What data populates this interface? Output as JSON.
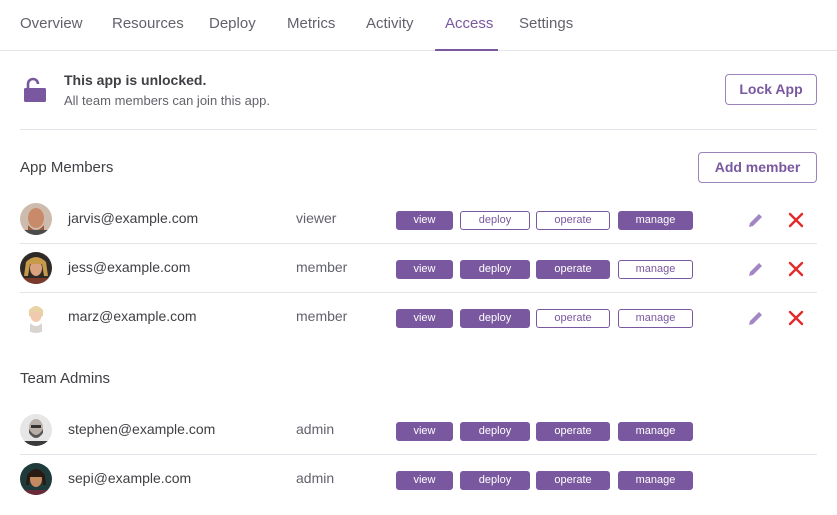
{
  "tabs": [
    {
      "label": "Overview"
    },
    {
      "label": "Resources"
    },
    {
      "label": "Deploy"
    },
    {
      "label": "Metrics"
    },
    {
      "label": "Activity"
    },
    {
      "label": "Access"
    },
    {
      "label": "Settings"
    }
  ],
  "active_tab": "Access",
  "lock": {
    "title": "This app is unlocked.",
    "subtitle": "All team members can join this app.",
    "button_label": "Lock App",
    "icon": "unlocked-padlock-icon"
  },
  "members_section": {
    "title": "App Members",
    "add_button_label": "Add member",
    "rows": [
      {
        "email": "jarvis@example.com",
        "role": "viewer",
        "permissions": [
          {
            "label": "view",
            "on": true
          },
          {
            "label": "deploy",
            "on": false
          },
          {
            "label": "operate",
            "on": false
          },
          {
            "label": "manage",
            "on": true
          }
        ]
      },
      {
        "email": "jess@example.com",
        "role": "member",
        "permissions": [
          {
            "label": "view",
            "on": true
          },
          {
            "label": "deploy",
            "on": true
          },
          {
            "label": "operate",
            "on": true
          },
          {
            "label": "manage",
            "on": false
          }
        ]
      },
      {
        "email": "marz@example.com",
        "role": "member",
        "permissions": [
          {
            "label": "view",
            "on": true
          },
          {
            "label": "deploy",
            "on": true
          },
          {
            "label": "operate",
            "on": false
          },
          {
            "label": "manage",
            "on": false
          }
        ]
      }
    ]
  },
  "admins_section": {
    "title": "Team Admins",
    "rows": [
      {
        "email": "stephen@example.com",
        "role": "admin",
        "permissions": [
          {
            "label": "view",
            "on": true
          },
          {
            "label": "deploy",
            "on": true
          },
          {
            "label": "operate",
            "on": true
          },
          {
            "label": "manage",
            "on": true
          }
        ]
      },
      {
        "email": "sepi@example.com",
        "role": "admin",
        "permissions": [
          {
            "label": "view",
            "on": true
          },
          {
            "label": "deploy",
            "on": true
          },
          {
            "label": "operate",
            "on": true
          },
          {
            "label": "manage",
            "on": true
          }
        ]
      }
    ]
  },
  "icons": {
    "edit": "pencil-icon",
    "remove": "close-x-icon"
  },
  "colors": {
    "accent": "#79589f",
    "danger": "#e32b2b",
    "edit_icon": "#a386c6"
  }
}
